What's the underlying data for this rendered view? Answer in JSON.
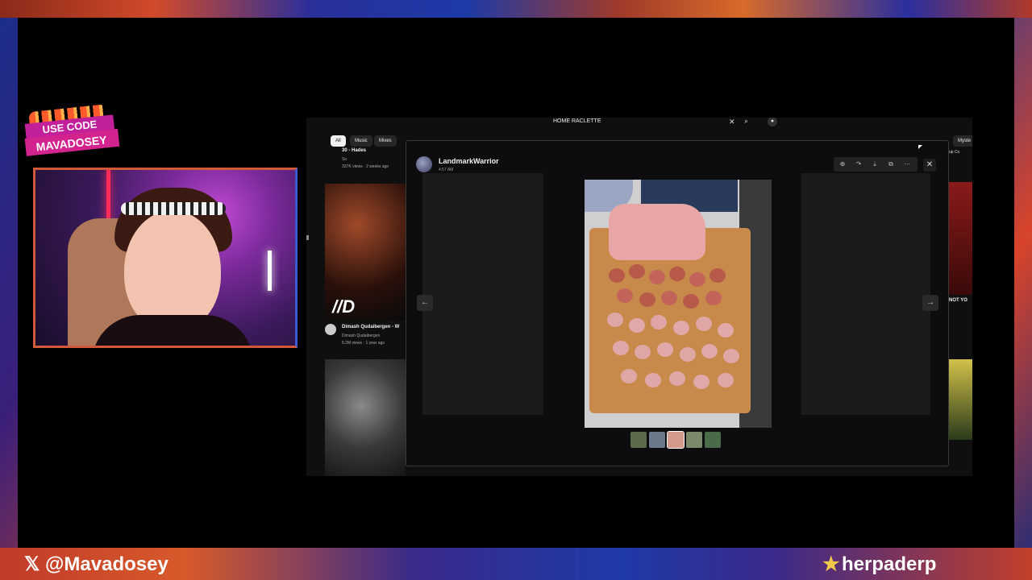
{
  "overlay": {
    "code_badge": {
      "line1": "USE CODE",
      "line2": "MAVADOSEY"
    },
    "x_handle": "@Mavadosey",
    "x_icon": "x-logo-icon",
    "streamer_name": "herpaderp",
    "star_icon": "star-icon"
  },
  "browser": {
    "search_query": "HOME RACLETTE",
    "chips": [
      "All",
      "Music",
      "Mixes"
    ],
    "active_chip": "All",
    "videos": [
      {
        "title": "30 - Hades",
        "meta1": "So",
        "meta2": "337K views · 2 weeks ago"
      },
      {
        "title": "Dimash Qudaibergen - W",
        "meta1": "Dimash Qudaibergen",
        "meta2": "5.2M views · 1 year ago"
      }
    ],
    "right_chip": "Myste",
    "right_snippet_1": "NOT YO",
    "right_snippet_2": "up Co"
  },
  "viewer": {
    "username": "LandmarkWarrior",
    "time": "4:57 AM",
    "toolbar_icons": [
      "zoom-in-icon",
      "forward-icon",
      "download-icon",
      "open-external-icon",
      "more-icon"
    ],
    "close_icon": "close-icon",
    "prev_icon": "arrow-left-icon",
    "next_icon": "arrow-right-icon",
    "image_alt": "Charcuterie board with sliced ham and sausage",
    "thumbnail_count": 5,
    "active_thumbnail": 3
  }
}
